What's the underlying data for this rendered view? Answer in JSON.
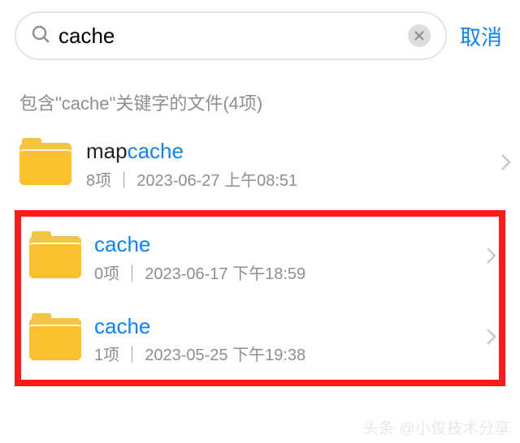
{
  "search": {
    "query": "cache",
    "placeholder": "",
    "cancel_label": "取消"
  },
  "section": {
    "header": "包含\"cache\"关键字的文件(4项)"
  },
  "results": [
    {
      "name_prefix": "map",
      "name_match": "cache",
      "subtitle": "8项 ｜ 2023-06-27 上午08:51",
      "highlighted": false
    },
    {
      "name_prefix": "",
      "name_match": "cache",
      "subtitle": "0项 ｜ 2023-06-17 下午18:59",
      "highlighted": true
    },
    {
      "name_prefix": "",
      "name_match": "cache",
      "subtitle": "1项 ｜ 2023-05-25 下午19:38",
      "highlighted": true
    }
  ],
  "watermark": "头条 @小俊技术分享"
}
